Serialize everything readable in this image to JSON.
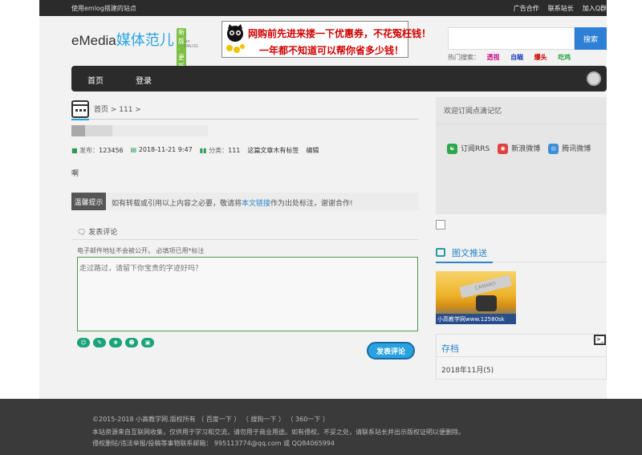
{
  "topbar": {
    "site_note": "使用emlog搭建的站点",
    "links": [
      "广告合作",
      "联系站长",
      "加入Q群"
    ]
  },
  "logo": {
    "en": "eMedia",
    "cn": "媒体范儿",
    "tag": "新版·更新",
    "sub": "For EMLOG"
  },
  "banner": {
    "line1": "网购前先进来搂一下优惠券，不花冤枉钱！",
    "line2": "一年都不知道可以帮你省多少钱！"
  },
  "search": {
    "placeholder": "",
    "button": "搜索"
  },
  "hot": {
    "label": "热门搜索：",
    "items": [
      {
        "text": "透视",
        "color": "#c71585"
      },
      {
        "text": "自瞄",
        "color": "#1e3fbf"
      },
      {
        "text": "爆头",
        "color": "#d10000"
      },
      {
        "text": "吃鸡",
        "color": "#2ca84a"
      }
    ]
  },
  "nav": {
    "items": [
      "首页",
      "登录"
    ]
  },
  "breadcrumb": "首页 >   111 >",
  "meta": {
    "author_label": "发布：",
    "author": "123456",
    "date": "2018-11-21 9:47",
    "category_label": "分类：",
    "category": "111",
    "tags": "这篇文章木有标签",
    "edit": "编辑"
  },
  "content": "啊",
  "notice": {
    "label": "温馨提示",
    "text_before": "如有转载或引用以上内容之必要，敬请将",
    "link": "本文链接",
    "text_after": "作为出处标注，谢谢合作!"
  },
  "comment": {
    "title": "发表评论",
    "note": "电子邮件地址不会被公开。 必填项已用*标注",
    "placeholder": "走过路过，请留下你宝贵的字迹好吗？",
    "emotes": [
      "☺",
      "✎",
      "❀",
      "☻",
      "▣"
    ],
    "submit": "发表评论"
  },
  "sidebar": {
    "subscribe_title": "欢迎订阅点滴记忆",
    "subscribe": [
      {
        "label": "订阅RRS",
        "color": "#2ca84a",
        "icon": "rss-icon"
      },
      {
        "label": "新浪微博",
        "color": "#e04040",
        "icon": "weibo-icon"
      },
      {
        "label": "腾讯微博",
        "color": "#3a8fd6",
        "icon": "tencent-weibo-icon"
      }
    ],
    "tuwen_title": "图文推送",
    "tuwen_caption": "小高教学网www.12580sk",
    "tuwen_car": "CAMARO",
    "archive_title": "存档",
    "archive_item": "2018年11月(5)"
  },
  "footer": {
    "line1": "©2015-2018 小高教学网.版权所有 （ 百度一下 ） （ 搜狗一下 ） （ 360一下 ）",
    "line2": "本站资源来自互联网收集，仅供用于学习和交流，请勿用于商业用途。如有侵权、不妥之处，请联系站长并出示版权证明以便删除。",
    "line3": "侵权删帖/违法举报/投稿等事物联系邮箱： 995113774@qq.com 或 QQ84065994"
  }
}
